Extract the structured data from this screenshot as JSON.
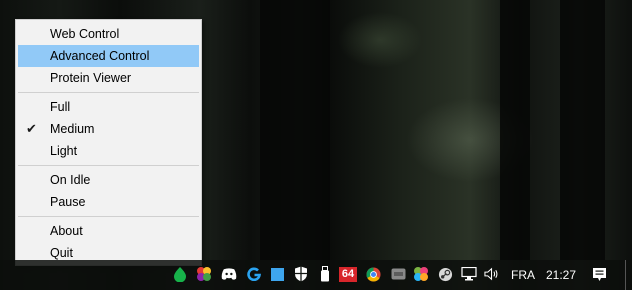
{
  "menu": {
    "items": [
      {
        "label": "Web Control"
      },
      {
        "label": "Advanced Control"
      },
      {
        "label": "Protein Viewer"
      },
      {
        "label": "Full"
      },
      {
        "label": "Medium"
      },
      {
        "label": "Light"
      },
      {
        "label": "On Idle"
      },
      {
        "label": "Pause"
      },
      {
        "label": "About"
      },
      {
        "label": "Quit"
      }
    ],
    "checked_item": "Medium",
    "highlighted_item": "Advanced Control"
  },
  "tray": {
    "badge_number": "64",
    "language": "FRA",
    "clock": "21:27",
    "icons": [
      "folding-at-home-icon",
      "color-flower-icon",
      "discord-icon",
      "logitech-g-icon",
      "blue-square-icon",
      "windows-security-shield-icon",
      "usb-drive-icon",
      "aida64-icon",
      "chrome-icon",
      "gray-app-icon",
      "color-flower-icon",
      "steam-icon",
      "network-icon",
      "volume-icon",
      "notification-icon"
    ]
  },
  "colors": {
    "menu_background": "#f2f2f2",
    "highlight": "#91c9f7",
    "taskbar": "#0c0e0c"
  }
}
